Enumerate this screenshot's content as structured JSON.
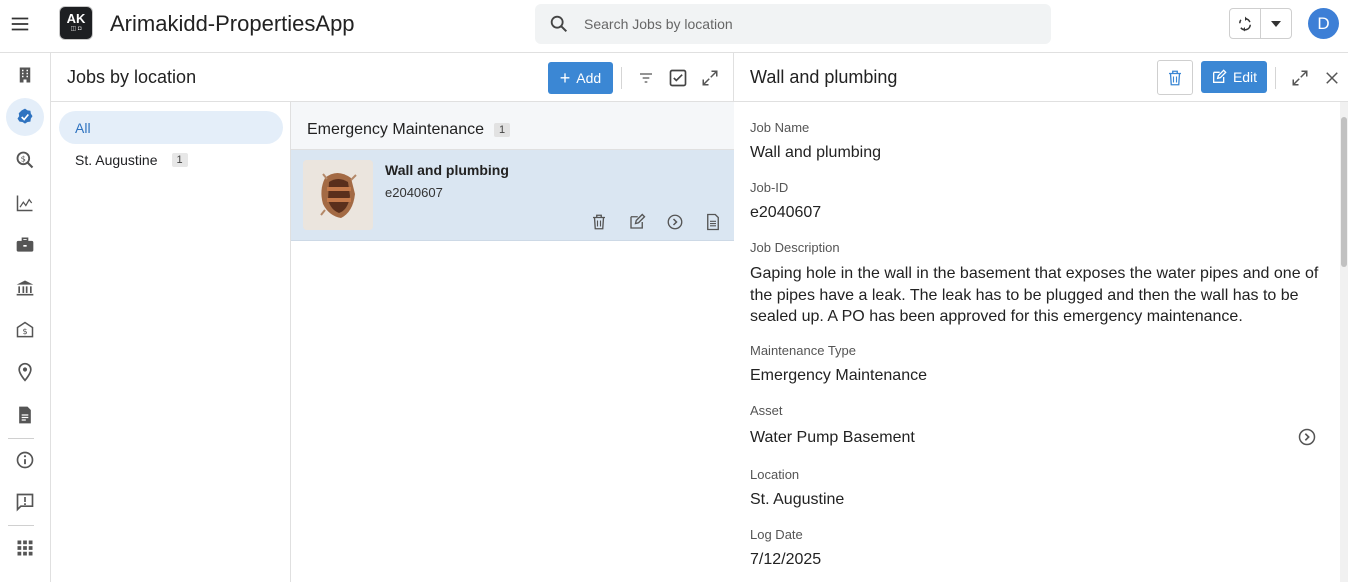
{
  "app": {
    "title": "Arimakidd-PropertiesApp",
    "logo_text": "AK",
    "search_placeholder": "Search Jobs by location",
    "avatar_initial": "D"
  },
  "colors": {
    "accent": "#3b87d4",
    "selected_bg": "#dae6f2",
    "avatar": "#3d7fd6"
  },
  "rail": {
    "items": [
      {
        "icon": "building-icon"
      },
      {
        "icon": "check-badge-icon",
        "active": true
      },
      {
        "icon": "search-dollar-icon"
      },
      {
        "icon": "chart-icon"
      },
      {
        "icon": "briefcase-icon"
      },
      {
        "icon": "bank-icon"
      },
      {
        "icon": "money-envelope-icon"
      },
      {
        "icon": "location-pin-icon"
      },
      {
        "icon": "document-icon"
      },
      {
        "icon": "info-icon"
      },
      {
        "icon": "feedback-icon"
      },
      {
        "icon": "apps-grid-icon"
      }
    ]
  },
  "list_panel": {
    "title": "Jobs by location",
    "add_label": "Add",
    "groups": [
      {
        "label": "All",
        "count": "",
        "active": true
      },
      {
        "label": "St. Augustine",
        "count": "1",
        "active": false
      }
    ],
    "section": {
      "title": "Emergency Maintenance",
      "count": "1"
    },
    "job": {
      "name": "Wall and plumbing",
      "id": "e2040607"
    }
  },
  "detail": {
    "title": "Wall and plumbing",
    "edit_label": "Edit",
    "fields": {
      "job_name_label": "Job Name",
      "job_name": "Wall and plumbing",
      "job_id_label": "Job-ID",
      "job_id": "e2040607",
      "description_label": "Job Description",
      "description": "Gaping hole in the wall in the basement that exposes the water pipes and one of the pipes have a leak.  The leak has to be plugged and then the wall has to be sealed up.  A PO has been approved for this emergency maintenance.",
      "maintenance_type_label": "Maintenance Type",
      "maintenance_type": "Emergency Maintenance",
      "asset_label": "Asset",
      "asset": "Water Pump Basement",
      "location_label": "Location",
      "location": "St. Augustine",
      "log_date_label": "Log Date",
      "log_date": "7/12/2025"
    }
  }
}
